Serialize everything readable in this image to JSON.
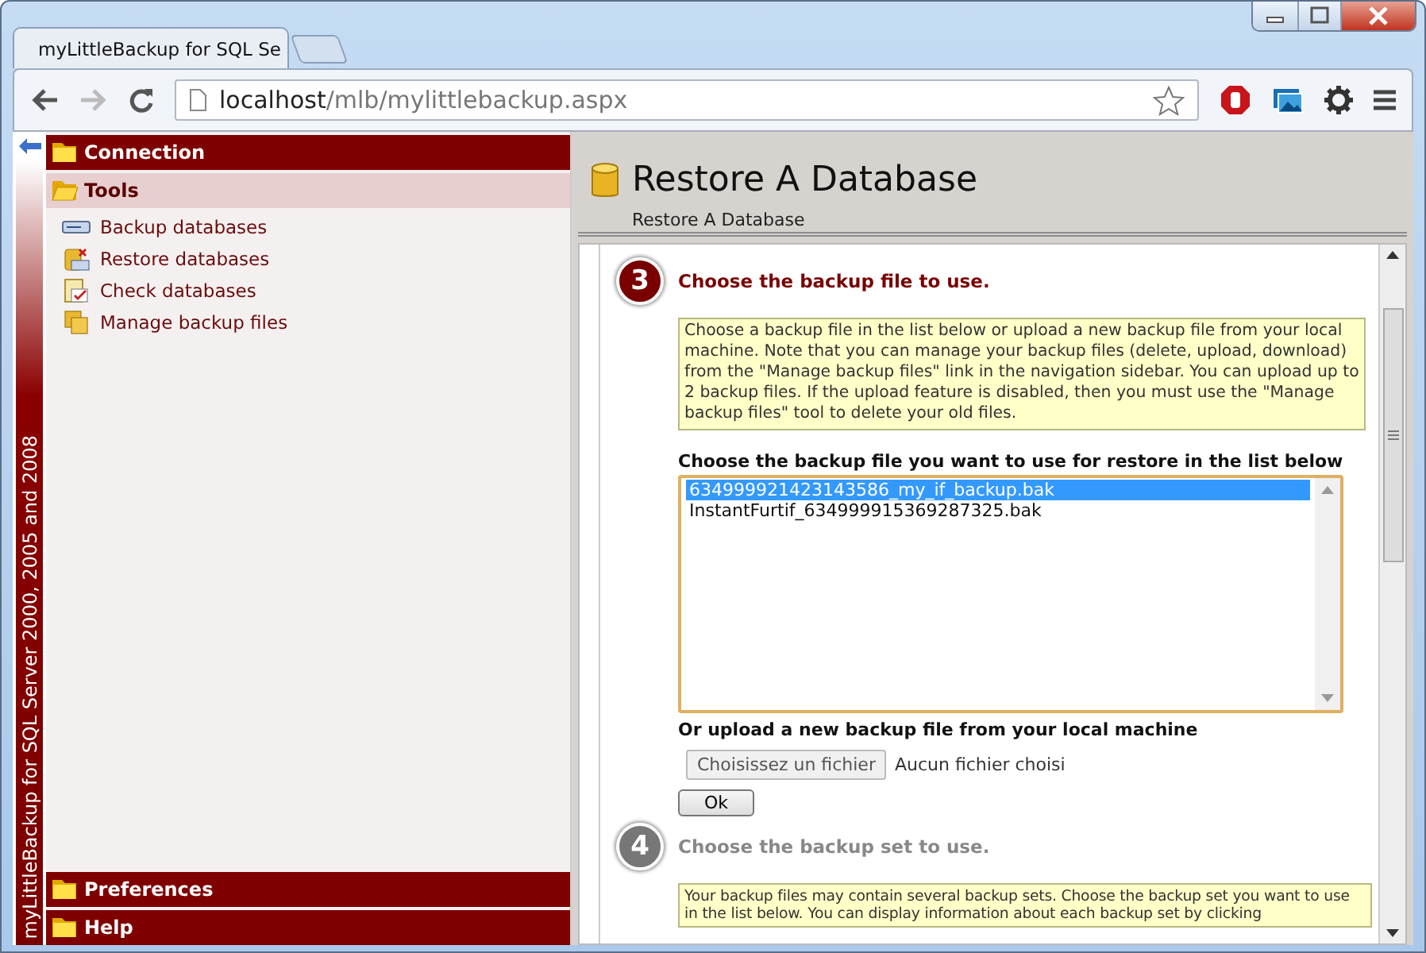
{
  "browser": {
    "tabs": [
      {
        "title": "myLittleBackup for SQL Se",
        "selected": true
      }
    ],
    "url_host": "localhost",
    "url_path": "/mlb/mylittlebackup.aspx"
  },
  "brand": "myLittleBackup for SQL Server 2000, 2005 and 2008",
  "sidebar": {
    "sections": [
      {
        "label": "Connection",
        "expanded": false
      },
      {
        "label": "Tools",
        "expanded": true,
        "items": [
          "Backup databases",
          "Restore databases",
          "Check databases",
          "Manage backup files"
        ]
      },
      {
        "label": "Preferences",
        "expanded": false
      },
      {
        "label": "Help",
        "expanded": false
      }
    ]
  },
  "page": {
    "title": "Restore A Database",
    "breadcrumb": "Restore A Database"
  },
  "steps": [
    {
      "number": "3",
      "title": "Choose the backup file to use.",
      "active": true,
      "note": "Choose a backup file in the list below or upload a new backup file from your local machine. Note that you can manage your backup files (delete, upload, download) from the \"Manage backup files\" link in the navigation sidebar. You can upload up to 2 backup files. If the upload feature is disabled, then you must use the \"Manage backup files\" tool to delete your old files.",
      "list_label": "Choose the backup file you want to use for restore in the list below",
      "files": [
        {
          "name": "634999921423143586_my_if_backup.bak",
          "selected": true
        },
        {
          "name": "InstantFurtif_634999915369287325.bak",
          "selected": false
        }
      ],
      "upload_label": "Or upload a new backup file from your local machine",
      "file_button": "Choisissez un fichier",
      "file_status": "Aucun fichier choisi",
      "ok_button": "Ok"
    },
    {
      "number": "4",
      "title": "Choose the backup set to use.",
      "active": false,
      "note": "Your backup files may contain several backup sets. Choose the backup set you want to use in the list below. You can display information about each backup set by clicking"
    }
  ]
}
